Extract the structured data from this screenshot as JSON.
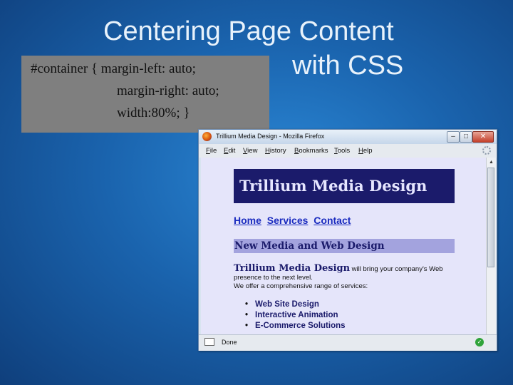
{
  "slide": {
    "title_line1": "Centering Page Content",
    "title_line2": "with CSS",
    "code_lines": [
      "#container { margin-left: auto;",
      "margin-right: auto;",
      "width:80%; }"
    ]
  },
  "browser": {
    "window_title": "Trillium Media Design - Mozilla Firefox",
    "menu": [
      {
        "first": "F",
        "rest": "ile"
      },
      {
        "first": "E",
        "rest": "dit"
      },
      {
        "first": "V",
        "rest": "iew"
      },
      {
        "first": "H",
        "rest": "istory"
      },
      {
        "first": "B",
        "rest": "ookmarks"
      },
      {
        "first": "T",
        "rest": "ools"
      },
      {
        "first": "H",
        "rest": "elp"
      }
    ],
    "status": "Done"
  },
  "page": {
    "header": "Trillium Media Design",
    "nav": [
      "Home",
      "Services",
      "Contact"
    ],
    "subheader": "New Media and Web Design",
    "intro_brand": "Trillium Media Design",
    "intro_rest": " will bring your company's Web presence to the next level.",
    "intro_line2": "We offer a comprehensive range of services:",
    "services": [
      "Web Site Design",
      "Interactive Animation",
      "E-Commerce Solutions"
    ]
  },
  "colors": {
    "slide_bg": "#1a63ad",
    "code_box_bg": "#7f7f7f",
    "site_header_bg": "#1b1b6b",
    "subheader_bg": "#a3a3de",
    "content_bg": "#e5e5fa",
    "link": "#1a2bbf"
  }
}
